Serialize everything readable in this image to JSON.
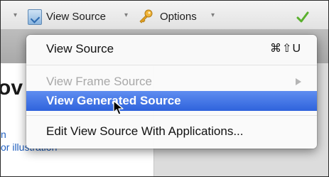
{
  "toolbar": {
    "view_source_label": "View Source",
    "options_label": "Options",
    "dropdown_arrow": "▾",
    "icons": [
      "view-source-document-icon",
      "key-options-icon",
      "checkmark-icon"
    ]
  },
  "background": {
    "heading_fragment": "ov",
    "link_1_fragment": "n",
    "link_2_fragment": "or illustration"
  },
  "menu": {
    "items": [
      {
        "label": "View Source",
        "shortcut": "⌘⇧U",
        "enabled": true
      },
      {
        "label": "View Frame Source",
        "enabled": false,
        "has_submenu": true
      },
      {
        "label": "View Generated Source",
        "highlighted": true,
        "enabled": true
      },
      {
        "label": "Edit View Source With Applications...",
        "enabled": true
      }
    ]
  },
  "colors": {
    "highlight": "#2f63dc",
    "disabled_text": "#a8a8a8",
    "link": "#1f5fbf",
    "check": "#5ab02e",
    "key": "#e0a020"
  }
}
